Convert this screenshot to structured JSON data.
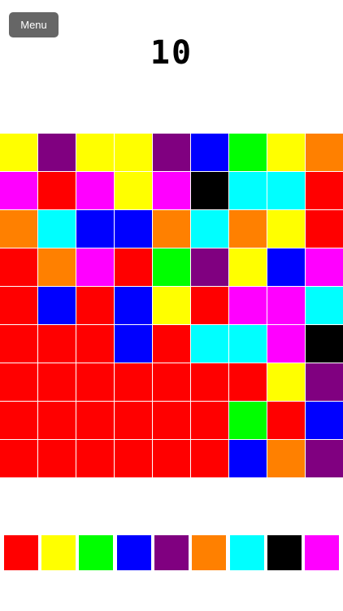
{
  "header": {
    "menu_label": "Menu",
    "moves_count": "10"
  },
  "board": {
    "rows": 9,
    "cols": 9,
    "cells": [
      [
        "yellow",
        "purple",
        "yellow",
        "yellow",
        "purple",
        "blue",
        "green",
        "yellow",
        "orange"
      ],
      [
        "magenta",
        "red",
        "magenta",
        "yellow",
        "magenta",
        "black",
        "cyan",
        "cyan",
        "red"
      ],
      [
        "orange",
        "cyan",
        "blue",
        "blue",
        "orange",
        "cyan",
        "orange",
        "yellow",
        "red"
      ],
      [
        "red",
        "orange",
        "magenta",
        "red",
        "green",
        "purple",
        "yellow",
        "blue",
        "magenta"
      ],
      [
        "red",
        "blue",
        "red",
        "blue",
        "yellow",
        "red",
        "magenta",
        "magenta",
        "cyan"
      ],
      [
        "red",
        "red",
        "red",
        "blue",
        "red",
        "cyan",
        "cyan",
        "magenta",
        "black"
      ],
      [
        "red",
        "red",
        "red",
        "red",
        "red",
        "red",
        "red",
        "yellow",
        "purple"
      ],
      [
        "red",
        "red",
        "red",
        "red",
        "red",
        "red",
        "green",
        "red",
        "blue"
      ],
      [
        "red",
        "red",
        "red",
        "red",
        "red",
        "red",
        "blue",
        "orange",
        "purple"
      ]
    ]
  },
  "palette": [
    "red",
    "yellow",
    "green",
    "blue",
    "purple",
    "orange",
    "cyan",
    "black",
    "magenta"
  ],
  "colors": {
    "red": "#ff0000",
    "yellow": "#ffff00",
    "green": "#00ff00",
    "blue": "#0000ff",
    "purple": "#800080",
    "orange": "#ff8000",
    "cyan": "#00ffff",
    "black": "#000000",
    "magenta": "#ff00ff"
  }
}
